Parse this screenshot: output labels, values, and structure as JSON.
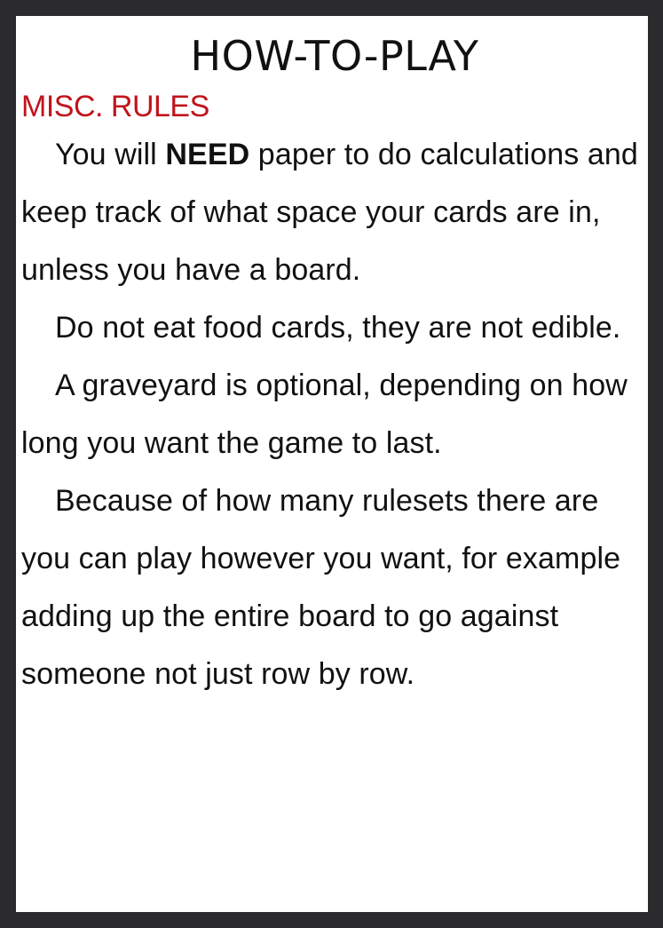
{
  "title": "HOW-TO-PLAY",
  "section": {
    "heading": "MISC. RULES",
    "heading_color": "#c0141c"
  },
  "paragraphs": {
    "p1_before": "You will ",
    "p1_bold": "NEED",
    "p1_after": " paper to do calculations and keep track of what space your cards are in, unless you have a board.",
    "p2": "Do not eat food cards, they are not edible.",
    "p3": "A graveyard is optional, depending on how long you want the game to last.",
    "p4": "Because of how many rulesets there are you can play however you want, for example adding up the entire board to go against someone not just row by row."
  }
}
